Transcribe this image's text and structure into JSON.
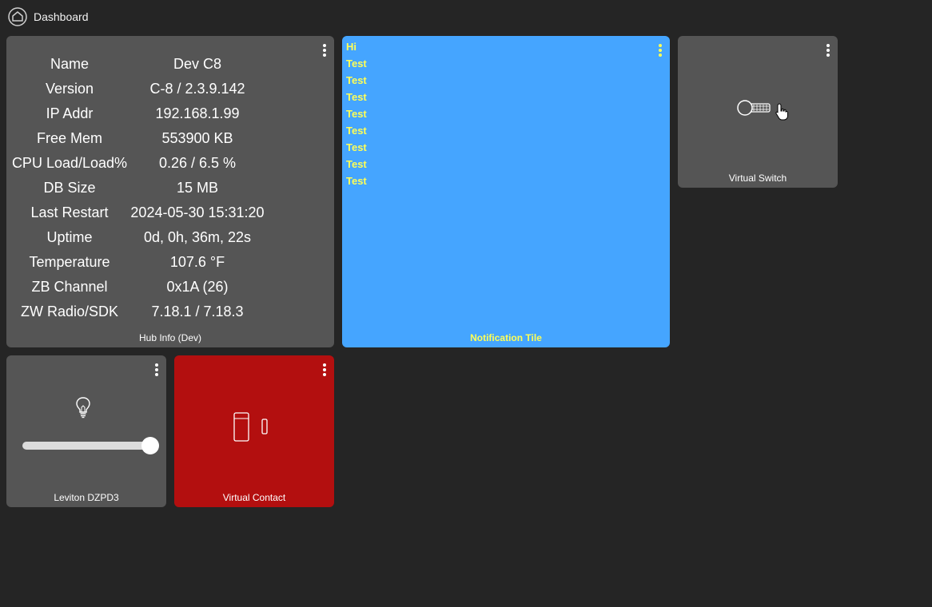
{
  "header": {
    "title": "Dashboard",
    "logo_icon": "hubitat-home-icon"
  },
  "hub_info": {
    "title": "Hub Info (Dev)",
    "rows": [
      {
        "key": "Name",
        "value": "Dev C8"
      },
      {
        "key": "Version",
        "value": "C-8 / 2.3.9.142"
      },
      {
        "key": "IP Addr",
        "value": "192.168.1.99"
      },
      {
        "key": "Free Mem",
        "value": "553900 KB"
      },
      {
        "key": "CPU Load/Load%",
        "value": "0.26 / 6.5 %"
      },
      {
        "key": "DB Size",
        "value": "15 MB"
      },
      {
        "key": "Last Restart",
        "value": "2024-05-30 15:31:20"
      },
      {
        "key": "Uptime",
        "value": "0d, 0h, 36m, 22s"
      },
      {
        "key": "Temperature",
        "value": "107.6 °F"
      },
      {
        "key": "ZB Channel",
        "value": "0x1A (26)"
      },
      {
        "key": "ZW Radio/SDK",
        "value": "7.18.1 / 7.18.3"
      }
    ]
  },
  "notification": {
    "title": "Notification Tile",
    "messages": [
      "Hi",
      "Test",
      "Test",
      "Test",
      "Test",
      "Test",
      "Test",
      "Test",
      "Test"
    ],
    "color": "#45a5ff",
    "text_color": "#ffff55"
  },
  "virtual_switch": {
    "title": "Virtual Switch",
    "icon": "toggle-switch-off-icon"
  },
  "dimmer": {
    "title": "Leviton DZPD3",
    "icon": "light-bulb-icon",
    "level_fraction": 1.0
  },
  "contact": {
    "title": "Virtual Contact",
    "icon": "door-contact-open-icon",
    "color": "#b30f0f"
  }
}
